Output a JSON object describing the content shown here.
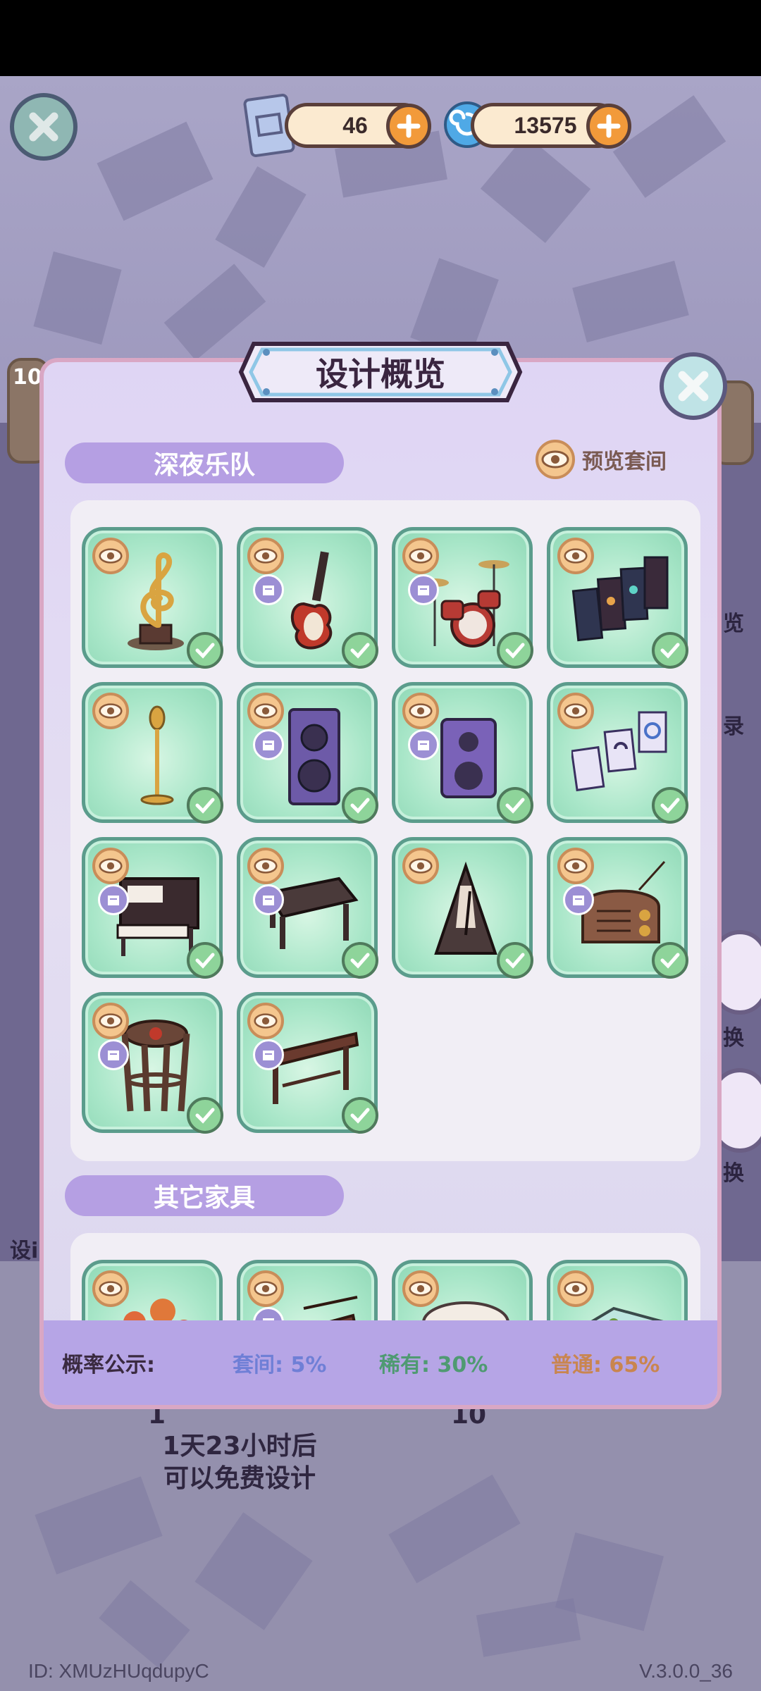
{
  "currency": {
    "blueprints": "46",
    "swirl": "13575"
  },
  "modal": {
    "title": "设计概览",
    "section1": {
      "name": "深夜乐队",
      "preview_label": "预览套间",
      "items": [
        {
          "icon": "treble-clef-trophy-icon",
          "boxed": false
        },
        {
          "icon": "electric-guitar-icon",
          "boxed": true
        },
        {
          "icon": "drum-kit-icon",
          "boxed": true
        },
        {
          "icon": "poster-set-icon",
          "boxed": false
        },
        {
          "icon": "microphone-stand-icon",
          "boxed": false
        },
        {
          "icon": "tall-speaker-icon",
          "boxed": true
        },
        {
          "icon": "small-speaker-icon",
          "boxed": true
        },
        {
          "icon": "hanging-banners-icon",
          "boxed": false
        },
        {
          "icon": "piano-icon",
          "boxed": true
        },
        {
          "icon": "bench-icon",
          "boxed": true
        },
        {
          "icon": "metronome-icon",
          "boxed": false
        },
        {
          "icon": "radio-icon",
          "boxed": true
        },
        {
          "icon": "drum-stool-icon",
          "boxed": true
        },
        {
          "icon": "guzheng-icon",
          "boxed": true
        }
      ]
    },
    "section2": {
      "name": "其它家具",
      "items": [
        {
          "icon": "flower-arrangement-icon",
          "boxed": false
        },
        {
          "icon": "instrument-icon",
          "boxed": true
        },
        {
          "icon": "round-table-icon",
          "boxed": false
        },
        {
          "icon": "aquarium-icon",
          "boxed": false
        }
      ]
    },
    "probability": {
      "label": "概率公示:",
      "suite": "套间: 5%",
      "rare": "稀有: 30%",
      "common": "普通: 65%"
    }
  },
  "background": {
    "free_design_line1": "1天23小时后",
    "free_design_line2": "可以免费设计",
    "left_num": "10",
    "mid_num": "10",
    "side_preview": "览",
    "side_record": "录",
    "side_exchange1": "换",
    "side_exchange2": "换",
    "side_design": "设i",
    "user_id": "ID:  XMUzHUqdupyC",
    "version": "V.3.0.0_36"
  },
  "colors": {
    "suite": "#6f7fd6",
    "rare": "#4f9a72",
    "common": "#c9854f"
  }
}
